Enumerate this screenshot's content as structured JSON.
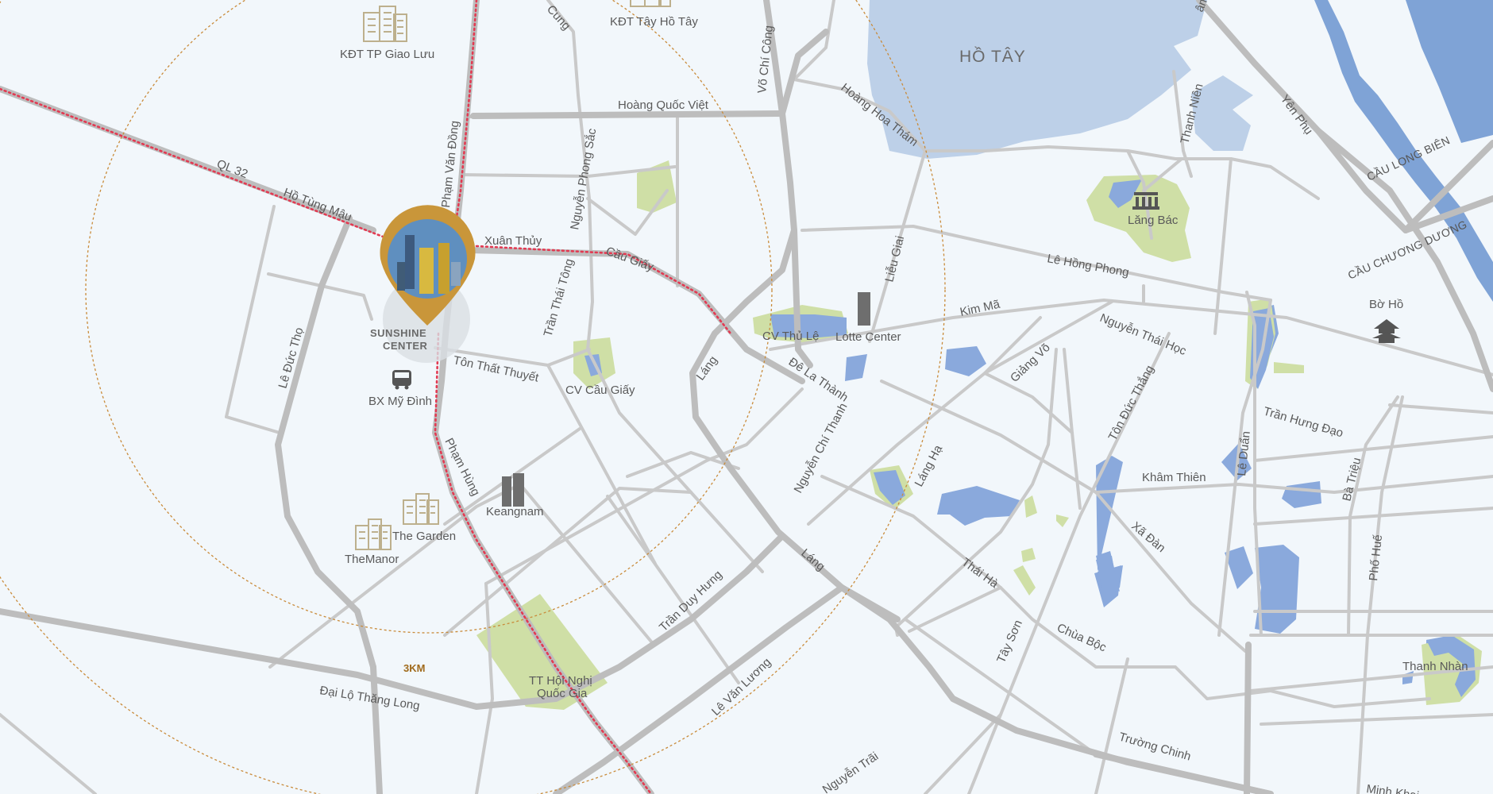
{
  "colors": {
    "background": "#f2f7fb",
    "road_minor": "#c9c9c9",
    "road_major": "#bdbdbd",
    "water_lake": "#bdd0e8",
    "water_pond": "#8aa9dc",
    "river": "#7fa3d6",
    "park": "#cfdfa6",
    "route_dots": "#e23a52",
    "radius_circle": "#c98b3a",
    "label_text": "#5a5a5a",
    "marker_gold": "#c9963a"
  },
  "radius": {
    "label": "3KM"
  },
  "project": {
    "name_line1": "SUNSHINE",
    "name_line2": "CENTER"
  },
  "lakes": {
    "ho_tay": "HỒ TÂY"
  },
  "bridges": {
    "long_bien": "CẦU LONG BIÊN",
    "chuong_duong": "CẦU CHƯƠNG DƯƠNG"
  },
  "landmarks": {
    "kdt_giao_luu": "KĐT TP Giao Lưu",
    "kdt_tay_ho_tay": "KĐT Tây Hồ Tây",
    "bx_my_dinh": "BX Mỹ Đình",
    "cv_cau_giay": "CV Cầu Giấy",
    "cv_thu_le": "CV Thủ Lệ",
    "lotte_center": "Lotte Center",
    "lang_bac": "Lăng Bác",
    "bo_ho": "Bờ Hồ",
    "thanh_nhan": "Thanh Nhàn",
    "keangnam": "Keangnam",
    "the_garden": "The Garden",
    "the_manor": "TheManor",
    "tt_hoi_nghi_1": "TT Hội Nghị",
    "tt_hoi_nghi_2": "Quốc Gia"
  },
  "streets": {
    "ql32": "QL 32",
    "ho_tung_mau": "Hồ Tùng Mậu",
    "pham_van_dong": "Phạm Văn Đồng",
    "xuan_thuy": "Xuân Thủy",
    "cau_giay": "Cầu Giấy",
    "hoang_quoc_viet": "Hoàng Quốc Việt",
    "nguyen_phong_sac": "Nguyễn Phong Sắc",
    "tran_thai_tong": "Trần Thái Tông",
    "ton_that_thuyet": "Tôn Thất Thuyết",
    "le_duc_tho": "Lê Đức Thọ",
    "pham_hung": "Phạm Hùng",
    "vo_chi_cong": "Võ Chí Công",
    "hoang_hoa_tham": "Hoàng Hoa Thám",
    "lieu_giai": "Liễu Giai",
    "le_hong_phong": "Lê Hồng Phong",
    "kim_ma": "Kim Mã",
    "nguyen_thai_hoc": "Nguyễn Thái Học",
    "de_la_thanh": "Đê La Thành",
    "giang_vo": "Giảng Võ",
    "lang_1": "Láng",
    "lang_2": "Láng",
    "nguyen_chi_thanh": "Nguyễn Chí Thanh",
    "lang_ha": "Láng Hạ",
    "ton_duc_thang": "Tôn Đức Thắng",
    "kham_thien": "Khâm Thiên",
    "le_duan": "Lê Duẩn",
    "tran_hung_dao": "Trần Hưng Đạo",
    "ba_trieu": "Bà Triệu",
    "pho_hue": "Phố Huế",
    "xa_dan": "Xã Đàn",
    "thai_ha": "Thái Hà",
    "chua_boc": "Chùa Bộc",
    "tay_son": "Tây Sơn",
    "tran_duy_hung": "Trần Duy Hưng",
    "le_van_luong": "Lê Văn Lương",
    "dai_lo_thang_long": "Đại Lộ Thăng Long",
    "truong_chinh": "Trường Chinh",
    "nguyen_trai": "Nguyễn Trãi",
    "yen_phu": "Yên Phụ",
    "thanh_nien": "Thanh Niên",
    "cung": "Cung",
    "am": "âm",
    "minh_khai": "Minh Khai"
  }
}
